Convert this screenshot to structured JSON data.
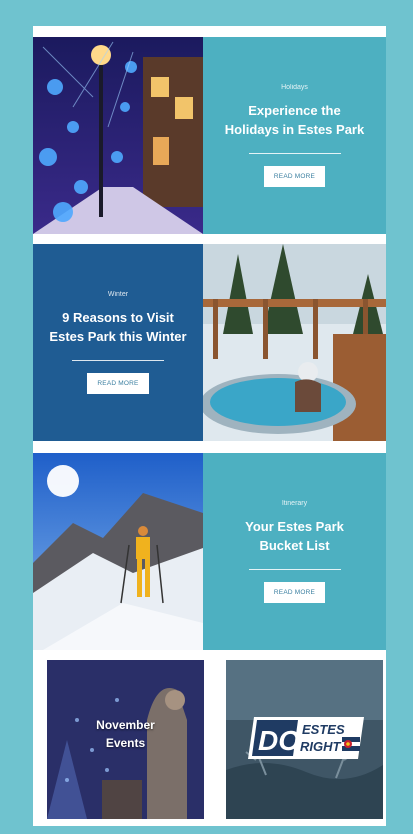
{
  "articles": [
    {
      "eyebrow": "Holidays",
      "title_line1": "Experience the",
      "title_line2": "Holidays in Estes Park",
      "cta": "READ MORE"
    },
    {
      "eyebrow": "Winter",
      "title_line1": "9 Reasons to Visit",
      "title_line2": "Estes Park this Winter",
      "cta": "READ MORE"
    },
    {
      "eyebrow": "Itinerary",
      "title_line1": "Your Estes Park",
      "title_line2": "Bucket List",
      "cta": "READ MORE"
    }
  ],
  "tiles": [
    {
      "title_line1": "November",
      "title_line2": "Events"
    },
    {
      "logo_text_1": "DO",
      "logo_text_2": "ESTES",
      "logo_text_3": "RIGHT"
    }
  ],
  "colors": {
    "border": "#6fc3cf",
    "teal": "#4db0c1",
    "navy": "#1f5c93"
  }
}
